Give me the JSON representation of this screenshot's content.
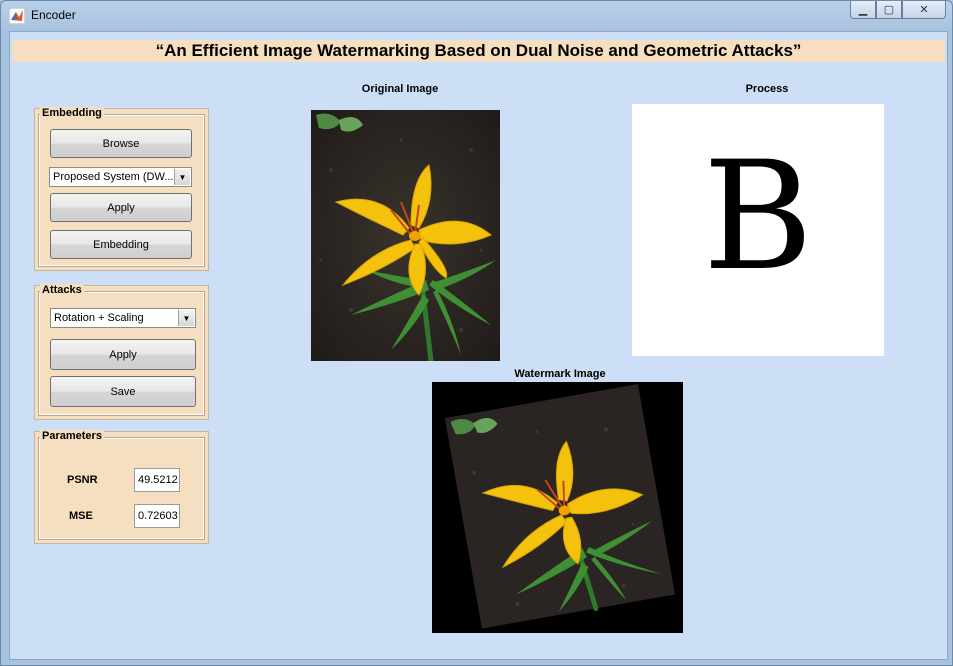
{
  "window": {
    "title": "Encoder"
  },
  "heading": "“An Efficient Image Watermarking Based on Dual Noise and Geometric Attacks”",
  "embedding": {
    "title": "Embedding",
    "browse_label": "Browse",
    "method_value": "Proposed System (DW...",
    "apply_label": "Apply",
    "embed_label": "Embedding"
  },
  "attacks": {
    "title": "Attacks",
    "attack_value": "Rotation + Scaling",
    "apply_label": "Apply",
    "save_label": "Save"
  },
  "parameters": {
    "title": "Parameters",
    "psnr_label": "PSNR",
    "psnr_value": "49.5212",
    "mse_label": "MSE",
    "mse_value": "0.72603"
  },
  "images": {
    "original_caption": "Original Image",
    "process_caption": "Process",
    "process_letter": "B",
    "watermark_caption": "Watermark Image"
  },
  "colors": {
    "panel_bg": "#f6dfc0",
    "client_bg": "#cddff7",
    "flower_yellow": "#f4c20d"
  },
  "icons": [
    "matlab-icon",
    "minimize-icon",
    "maximize-icon",
    "close-icon",
    "dropdown-arrow-icon"
  ]
}
